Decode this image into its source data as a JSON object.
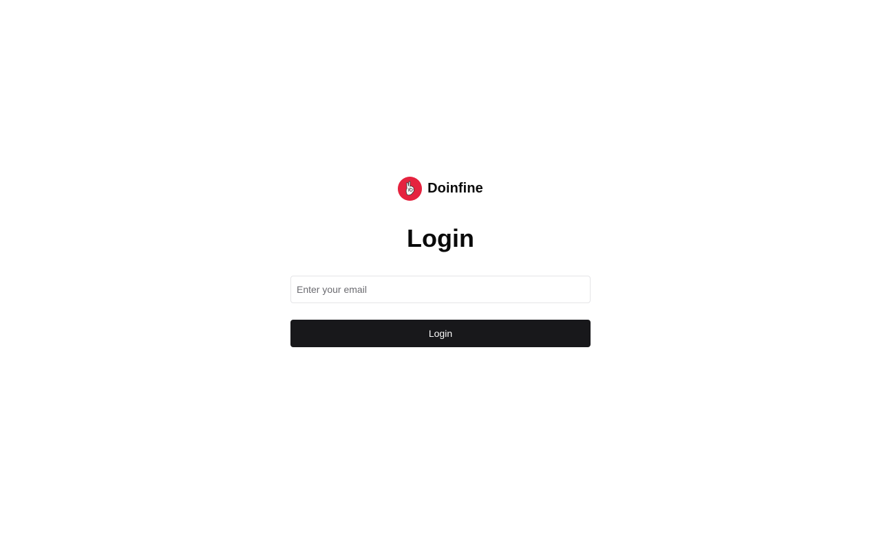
{
  "brand": {
    "name": "Doinfine",
    "logo_icon": "hand-ok-gesture-icon",
    "logo_color": "#e5233f"
  },
  "page": {
    "title": "Login"
  },
  "form": {
    "email_value": "",
    "email_placeholder": "Enter your email",
    "submit_label": "Login",
    "submit_color": "#18181b"
  }
}
